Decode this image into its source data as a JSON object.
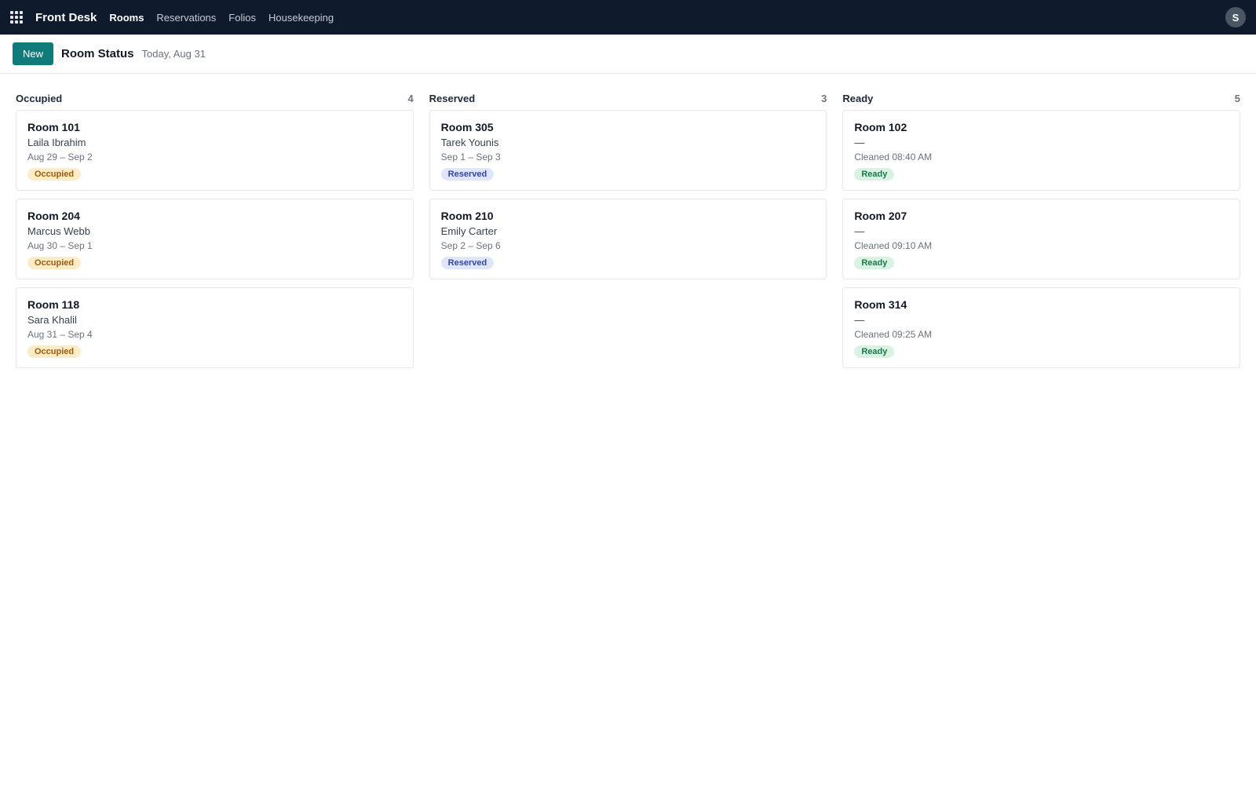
{
  "topbar": {
    "brand": "Front Desk",
    "nav": [
      "Rooms",
      "Reservations",
      "Folios",
      "Housekeeping"
    ],
    "active_nav": "Rooms",
    "avatar_initial": "S"
  },
  "controls": {
    "new_label": "New",
    "title": "Room Status",
    "date": "Today, Aug 31"
  },
  "columns": [
    {
      "title": "Occupied",
      "count": "4",
      "cards": [
        {
          "room": "Room 101",
          "guest": "Laila Ibrahim",
          "meta": "Aug 29 – Sep 2",
          "badge": "Occupied"
        },
        {
          "room": "Room 204",
          "guest": "Marcus Webb",
          "meta": "Aug 30 – Sep 1",
          "badge": "Occupied"
        },
        {
          "room": "Room 118",
          "guest": "Sara Khalil",
          "meta": "Aug 31 – Sep 4",
          "badge": "Occupied"
        }
      ]
    },
    {
      "title": "Reserved",
      "count": "3",
      "cards": [
        {
          "room": "Room 305",
          "guest": "Tarek Younis",
          "meta": "Sep 1 – Sep 3",
          "badge": "Reserved"
        },
        {
          "room": "Room 210",
          "guest": "Emily Carter",
          "meta": "Sep 2 – Sep 6",
          "badge": "Reserved"
        }
      ]
    },
    {
      "title": "Ready",
      "count": "5",
      "cards": [
        {
          "room": "Room 102",
          "guest": "—",
          "meta": "Cleaned 08:40 AM",
          "badge": "Ready"
        },
        {
          "room": "Room 207",
          "guest": "—",
          "meta": "Cleaned 09:10 AM",
          "badge": "Ready"
        },
        {
          "room": "Room 314",
          "guest": "—",
          "meta": "Cleaned 09:25 AM",
          "badge": "Ready"
        }
      ]
    }
  ],
  "colors": {
    "topbar": "#0f1b2d",
    "primary_button": "#0f7b7a",
    "occupied_badge": "#fdecc8",
    "reserved_badge": "#dfe6fb",
    "ready_badge": "#d9f2e4"
  }
}
